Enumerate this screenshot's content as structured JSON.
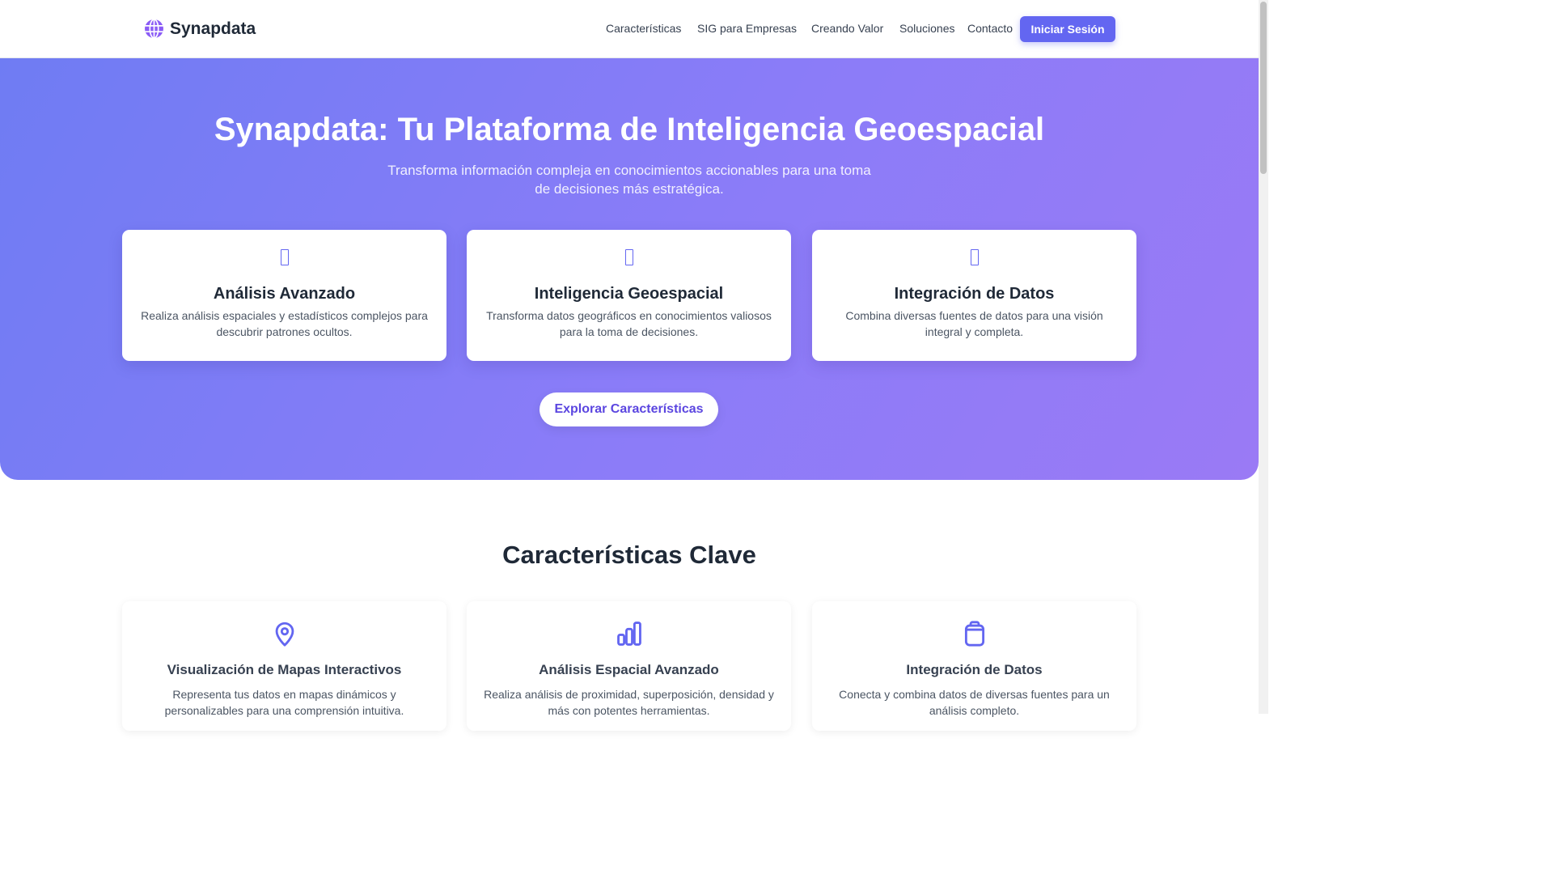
{
  "brand": {
    "name": "Synapdata",
    "logo_icon": "globe-icon"
  },
  "nav": {
    "links": [
      "Características",
      "SIG para Empresas",
      "Creando Valor",
      "Soluciones",
      "Contacto"
    ],
    "login_label": "Iniciar Sesión"
  },
  "hero": {
    "title": "Synapdata: Tu Plataforma de Inteligencia Geoespacial",
    "subtitle": "Transforma información compleja en conocimientos accionables para una toma de decisiones más estratégica.",
    "cards": [
      {
        "title": "Análisis Avanzado",
        "desc": "Realiza análisis espaciales y estadísticos complejos para descubrir patrones ocultos."
      },
      {
        "title": "Inteligencia Geoespacial",
        "desc": "Transforma datos geográficos en conocimientos valiosos para la toma de decisiones."
      },
      {
        "title": "Integración de Datos",
        "desc": "Combina diversas fuentes de datos para una visión integral y completa."
      }
    ],
    "cta_label": "Explorar Características"
  },
  "features": {
    "title": "Características Clave",
    "cards": [
      {
        "icon": "map-pin-icon",
        "title": "Visualización de Mapas Interactivos",
        "desc": "Representa tus datos en mapas dinámicos y personalizables para una comprensión intuitiva."
      },
      {
        "icon": "bar-chart-icon",
        "title": "Análisis Espacial Avanzado",
        "desc": "Realiza análisis de proximidad, superposición, densidad y más con potentes herramientas."
      },
      {
        "icon": "clipboard-icon",
        "title": "Integración de Datos",
        "desc": "Conecta y combina datos de diversas fuentes para un análisis completo."
      }
    ]
  },
  "colors": {
    "accent": "#6366f1",
    "hero_start": "#6f7cf3",
    "hero_end": "#9a7af5",
    "text": "#1f2937"
  }
}
